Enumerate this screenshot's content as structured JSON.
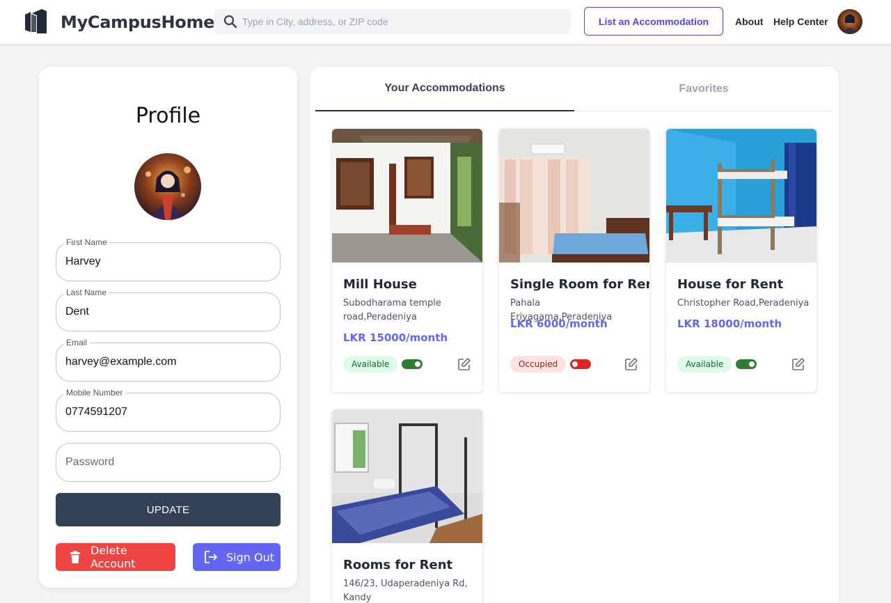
{
  "header": {
    "brand": "MyCampusHome",
    "search_placeholder": "Type in City, address, or ZIP code",
    "list_button": "List an Accommodation",
    "nav_about": "About",
    "nav_help": "Help Center"
  },
  "profile": {
    "title": "Profile",
    "first_name_label": "First Name",
    "first_name": "Harvey",
    "last_name_label": "Last Name",
    "last_name": "Dent",
    "email_label": "Email",
    "email": "harvey@example.com",
    "mobile_label": "Mobile Number",
    "mobile": "0774591207",
    "password_placeholder": "Password",
    "update_button": "UPDATE",
    "delete_button": "Delete Account",
    "signout_button": "Sign Out"
  },
  "tabs": {
    "active": "Your Accommodations",
    "inactive": "Favorites"
  },
  "listings": [
    {
      "title": "Mill House",
      "address": "Subodharama temple road,Peradeniya",
      "price": "LKR 15000/month",
      "status": "Available",
      "toggle_on": true
    },
    {
      "title": "Single Room for Rent",
      "address": "Pahala Eriyagama,Peradeniya",
      "price": "LKR 6000/month",
      "status": "Occupied",
      "toggle_on": false
    },
    {
      "title": "House for Rent",
      "address": "Christopher Road,Peradeniya",
      "price": "LKR 18000/month",
      "status": "Available",
      "toggle_on": true
    },
    {
      "title": "Rooms for Rent",
      "address": "146/23, Udaperadeniya Rd, Kandy",
      "price": "",
      "status": "",
      "toggle_on": null
    }
  ],
  "colors": {
    "accent": "#6366f1",
    "dark_button": "#334155",
    "danger": "#ef4444",
    "available_bg": "#dcfce7",
    "occupied_bg": "#fee2e2"
  },
  "icons": {
    "logo": "building-logo-icon",
    "search": "search-icon",
    "delete": "trash-icon",
    "signout": "sign-out-icon",
    "edit": "edit-icon"
  }
}
